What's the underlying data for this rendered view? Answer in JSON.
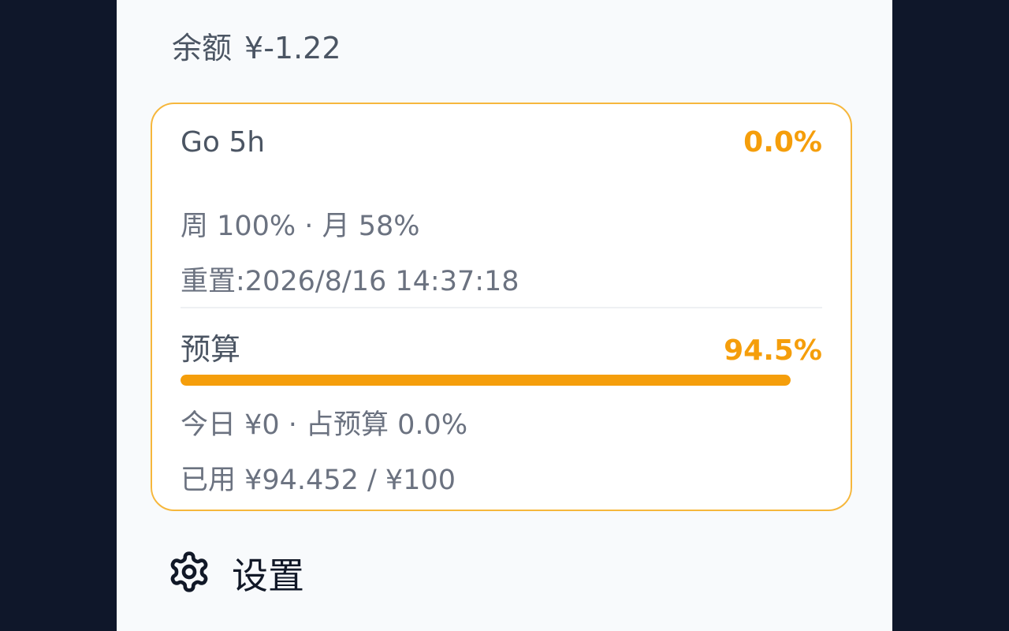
{
  "balance": {
    "label": "余额",
    "value": "¥-1.22"
  },
  "plan": {
    "name": "Go 5h",
    "percent": "0.0%",
    "usage": "周 100% · 月 58%",
    "reset": "重置:2026/8/16 14:37:18"
  },
  "budget": {
    "label": "预算",
    "percent": "94.5%",
    "fill_fraction": 1.0,
    "today": "今日 ¥0 · 占预算 0.0%",
    "used": "已用 ¥94.452 / ¥100"
  },
  "settings": {
    "label": "设置",
    "icon": "gear-icon"
  },
  "colors": {
    "accent": "#f59e0b",
    "card_border": "#f6b73c",
    "background": "#0f172a",
    "panel": "#f8fafc"
  }
}
